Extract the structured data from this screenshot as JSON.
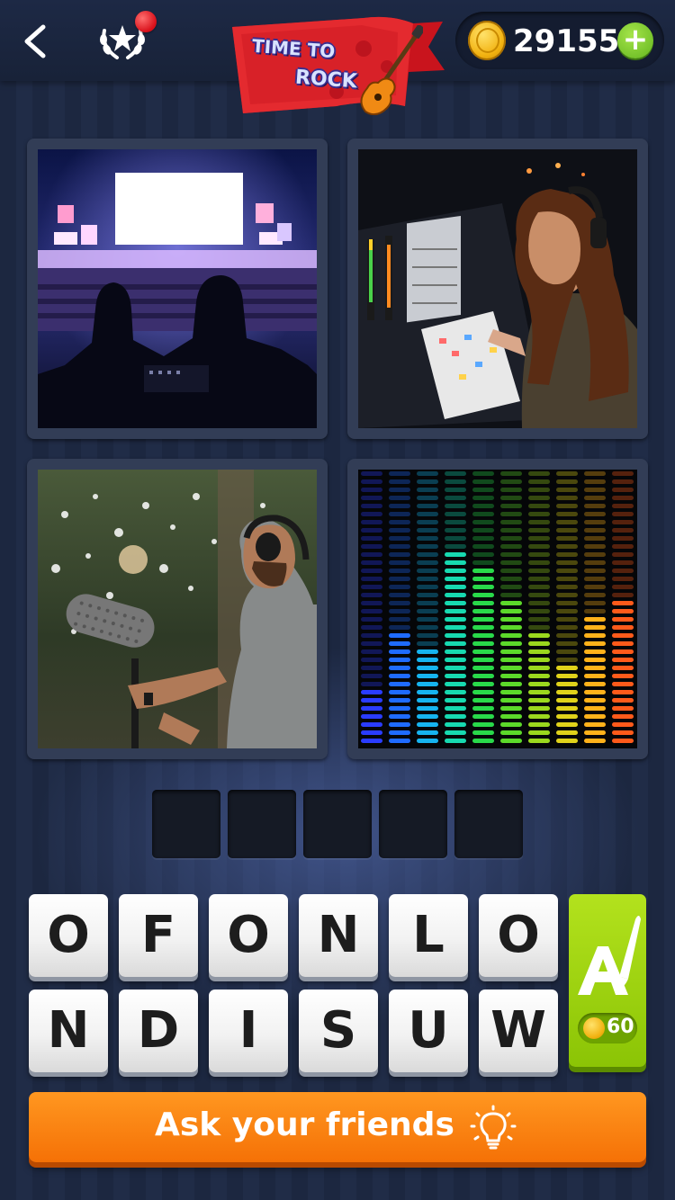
{
  "header": {
    "back_icon": "chevron-left-icon",
    "achievements_icon": "star-laurel-icon",
    "logo": {
      "line1": "TIME TO",
      "line2": "ROCK",
      "icon": "guitar-icon"
    },
    "coins": "29155",
    "add_coins_icon": "plus-icon"
  },
  "puzzle": {
    "pictures": [
      {
        "name": "concert-mixing-desk-photo"
      },
      {
        "name": "studio-engineer-photo"
      },
      {
        "name": "boom-microphone-photo"
      },
      {
        "name": "equalizer-bars-image"
      }
    ],
    "answer_length": 5,
    "letters_row1": [
      "O",
      "F",
      "O",
      "N",
      "L",
      "O"
    ],
    "letters_row2": [
      "N",
      "D",
      "I",
      "S",
      "U",
      "W"
    ]
  },
  "hint": {
    "icon": "brush-letter-icon",
    "cost": "60"
  },
  "ask_button": {
    "label": "Ask your friends",
    "icon": "lightbulb-icon"
  },
  "colors": {
    "accent_orange": "#f57106",
    "hint_green": "#8bc405",
    "coin_gold": "#f2b211",
    "badge_red": "#d80f19"
  }
}
